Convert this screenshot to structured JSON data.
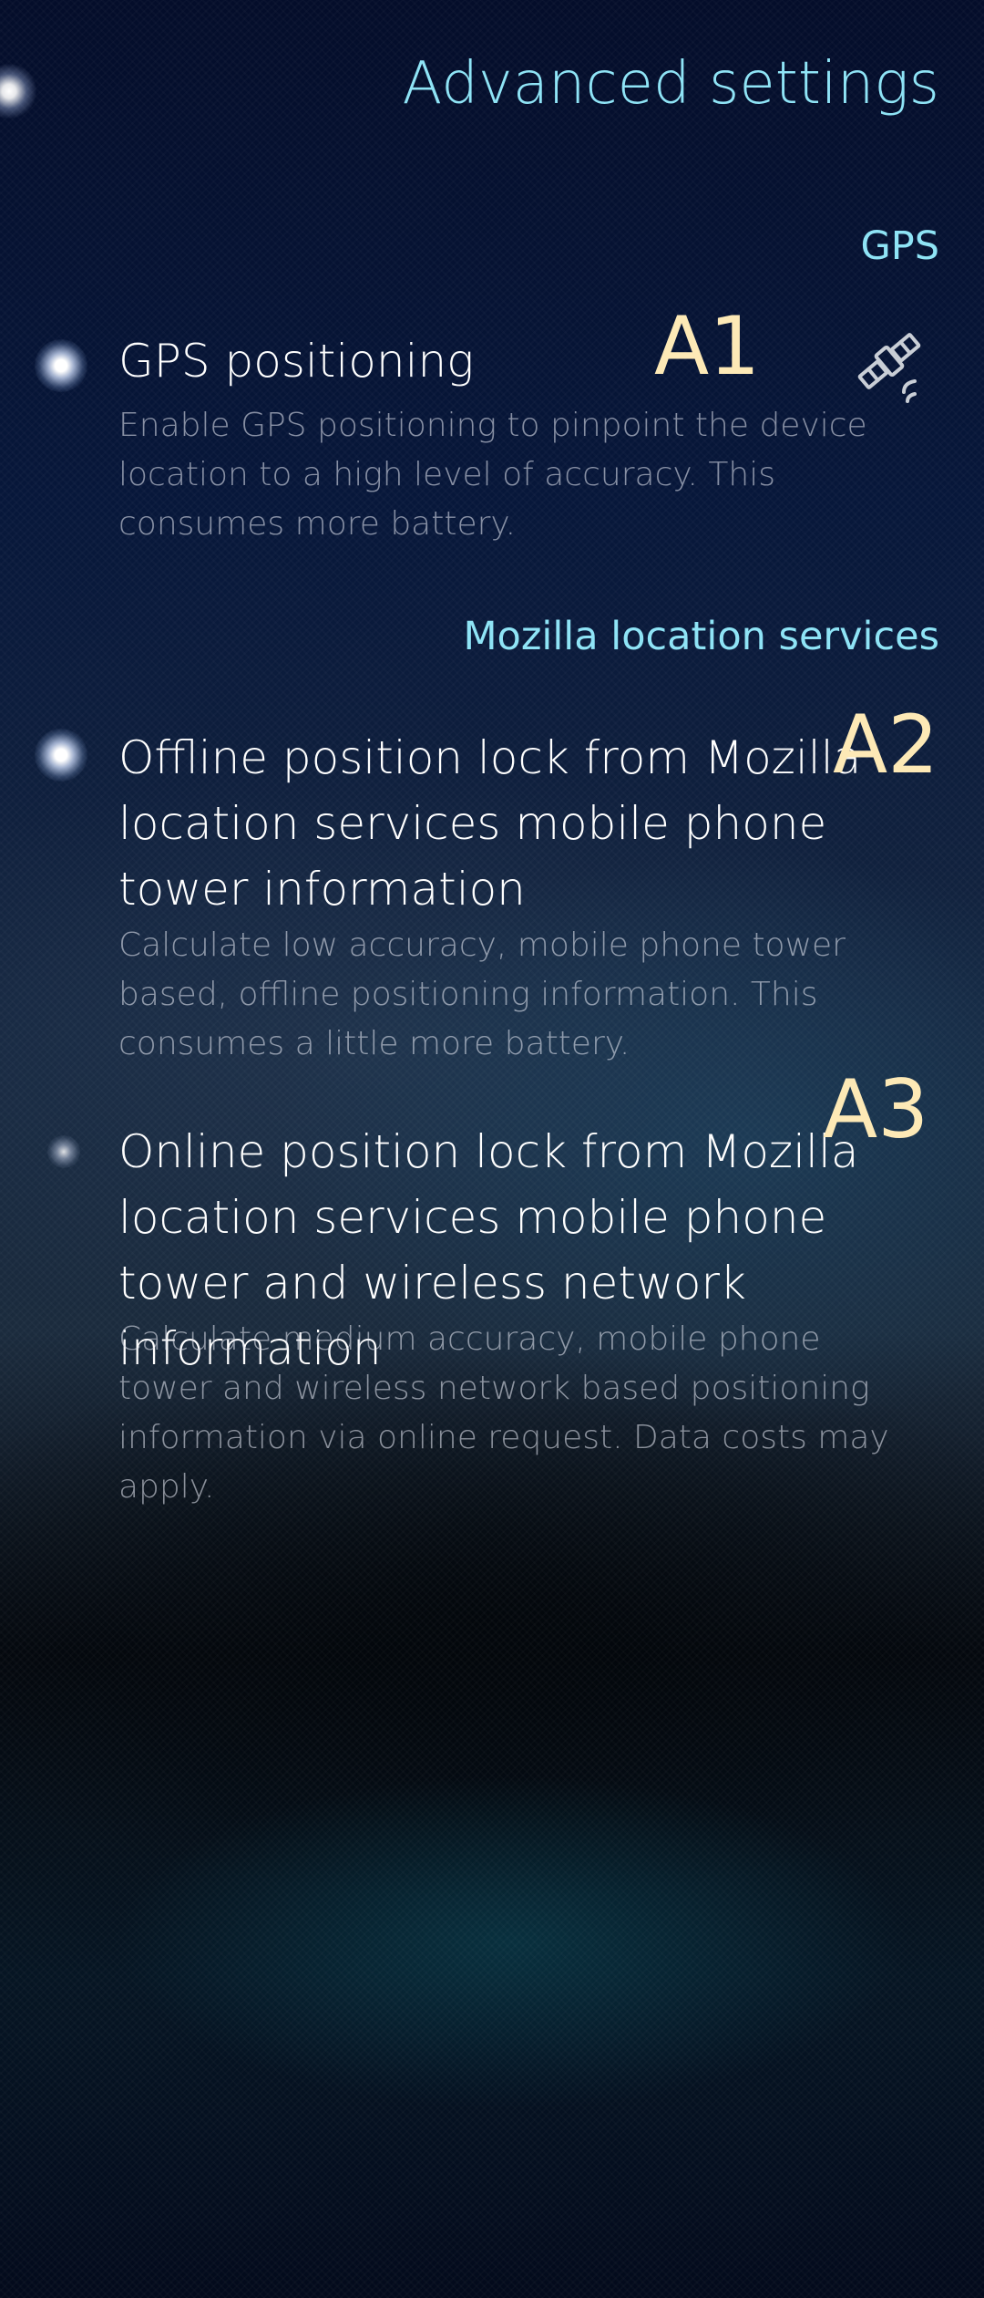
{
  "header": {
    "title": "Advanced settings"
  },
  "sections": [
    {
      "header": "GPS",
      "items": [
        {
          "title": "GPS positioning",
          "description": "Enable GPS positioning to pinpoint the device location to a high level of accuracy. This consumes more battery.",
          "enabled": true,
          "annotation": "A1",
          "icon": "satellite-icon"
        }
      ]
    },
    {
      "header": "Mozilla location services",
      "items": [
        {
          "title": "Offline position lock from Mozilla location services mobile phone tower information",
          "description": "Calculate low accuracy, mobile phone tower based, offline positioning information. This consumes a little more battery.",
          "enabled": true,
          "annotation": "A2"
        },
        {
          "title": "Online position lock from Mozilla location services mobile phone tower and wireless network information",
          "description": "Calculate medium accuracy, mobile phone tower and wireless network based positioning information via online request. Data costs may apply.",
          "enabled": false,
          "annotation": "A3"
        }
      ]
    }
  ],
  "colors": {
    "accent": "#8fe4f6",
    "annotation": "#fde9b6",
    "title": "#ffffff",
    "description": "#b9bdc6"
  }
}
